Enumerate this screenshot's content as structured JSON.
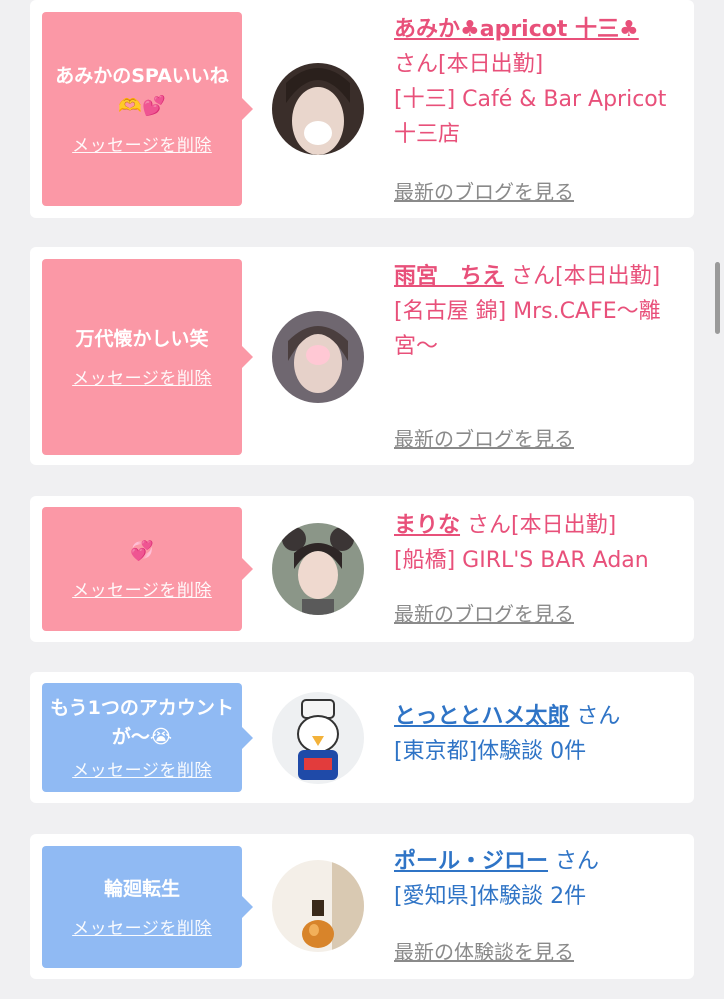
{
  "colors": {
    "pink_bubble": "#fb98a6",
    "blue_bubble": "#90baf3",
    "pink_text": "#e8507a",
    "blue_text": "#2f74c6",
    "card_bg": "#ffffff",
    "page_bg": "#f0f0f2"
  },
  "delete_label": "メッセージを削除",
  "cards": [
    {
      "message": "あみかのSPAいいね🫶💕",
      "name": "あみか♣apricot 十三♣",
      "suffix": "さん[本日出勤]",
      "shop": "[十三] Café & Bar Apricot 十三店",
      "link": "最新のブログを見る"
    },
    {
      "message": "万代懐かしい笑",
      "name": "雨宮　ちえ",
      "suffix": "さん[本日出勤]",
      "shop": "[名古屋 錦] Mrs.CAFE〜離宮〜",
      "link": "最新のブログを見る"
    },
    {
      "message": "💞",
      "name": "まりな",
      "suffix": "さん[本日出勤]",
      "shop": "[船橋] GIRL'S BAR Adan",
      "link": "最新のブログを見る"
    },
    {
      "message": "もう1つのアカウントが〜😭",
      "name": "とっととハメ太郎",
      "suffix": "さん",
      "shop": "[東京都]体験談 0件",
      "link": ""
    },
    {
      "message": "輪廻転生",
      "name": "ポール・ジロー",
      "suffix": "さん",
      "shop": "[愛知県]体験談 2件",
      "link": "最新の体験談を見る"
    }
  ]
}
